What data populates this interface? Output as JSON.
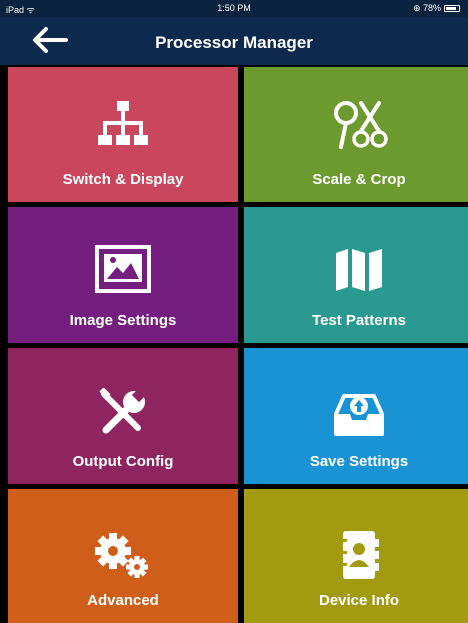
{
  "status": {
    "carrier": "iPad ᯤ",
    "time": "1:50 PM",
    "battery": "⊕ 78%"
  },
  "header": {
    "title": "Processor Manager"
  },
  "tiles": [
    {
      "label": "Switch & Display",
      "color": "#c9465c",
      "icon": "hierarchy-icon"
    },
    {
      "label": "Scale & Crop",
      "color": "#6d9a2f",
      "icon": "scissors-magnifier-icon"
    },
    {
      "label": "Image Settings",
      "color": "#741f80",
      "icon": "picture-icon"
    },
    {
      "label": "Test Patterns",
      "color": "#2a9a91",
      "icon": "map-icon"
    },
    {
      "label": "Output Config",
      "color": "#8e2560",
      "icon": "tools-icon"
    },
    {
      "label": "Save Settings",
      "color": "#1a93d5",
      "icon": "inbox-upload-icon"
    },
    {
      "label": "Advanced",
      "color": "#ce5e1a",
      "icon": "gears-icon"
    },
    {
      "label": "Device Info",
      "color": "#a29b10",
      "icon": "contacts-book-icon"
    }
  ]
}
